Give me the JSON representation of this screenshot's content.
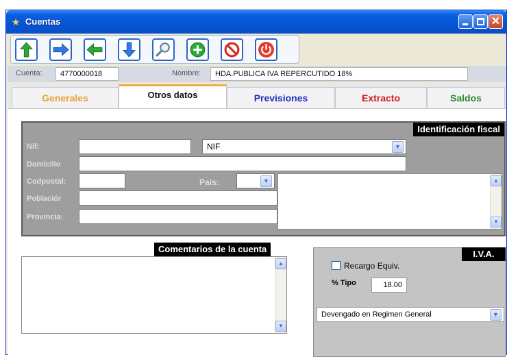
{
  "window": {
    "title": "Cuentas",
    "app_icon": "account-app-icon"
  },
  "toolbar": {
    "buttons": [
      {
        "name": "up-arrow-icon",
        "color": "#2ea63a"
      },
      {
        "name": "right-arrow-icon",
        "color": "#2f7be6"
      },
      {
        "name": "left-arrow-icon",
        "color": "#2ea63a"
      },
      {
        "name": "down-arrow-icon",
        "color": "#2f7be6"
      },
      {
        "name": "search-icon",
        "color": "#6a7d96"
      },
      {
        "name": "add-icon",
        "color": "#2ea63a"
      },
      {
        "name": "cancel-icon",
        "color": "#d82a1e"
      },
      {
        "name": "power-icon",
        "color": "#e53b2c"
      }
    ]
  },
  "info": {
    "cuenta_label": "Cuenta:",
    "cuenta_value": "4770000018",
    "nombre_label": "Nombre:",
    "nombre_value": "HDA.PUBLICA IVA REPERCUTIDO 18%"
  },
  "tabs": [
    {
      "label": "Generales",
      "color": "#e8a33a"
    },
    {
      "label": "Otros datos",
      "color": "#111111"
    },
    {
      "label": "Previsiones",
      "color": "#1f2fb8"
    },
    {
      "label": "Extracto",
      "color": "#d21d1d"
    },
    {
      "label": "Saldos",
      "color": "#2f8a33"
    }
  ],
  "fiscal": {
    "heading": "Identificación fiscal",
    "nif_label": "Nif:",
    "nif_value": "",
    "nif_type": "NIF",
    "domicilio_label": "Domicilio",
    "domicilio_value": "",
    "codpostal_label": "Codpostal:",
    "codpostal_value": "",
    "pais_label": "País:",
    "pais_value": "",
    "poblacion_label": "Poblaciór",
    "poblacion_value": "",
    "provincia_label": "Provincia:",
    "provincia_value": ""
  },
  "comentarios": {
    "heading": "Comentarios de la cuenta",
    "value": ""
  },
  "iva": {
    "heading": "I.V.A.",
    "recargo_label": "Recargo Equiv.",
    "recargo_checked": false,
    "tipo_label": "% Tipo",
    "tipo_value": "18.00",
    "regimen_value": "Devengado en Regimen General"
  }
}
